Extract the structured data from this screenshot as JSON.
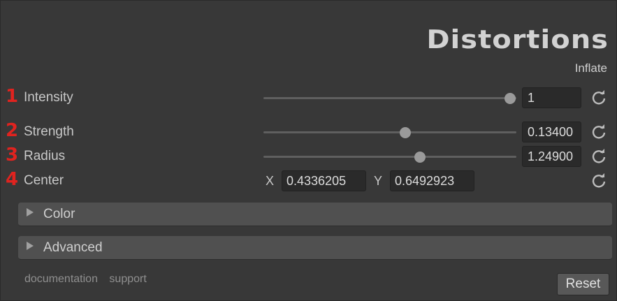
{
  "header": {
    "title": "Distortions",
    "subtitle": "Inflate"
  },
  "properties": [
    {
      "id": "intensity",
      "number": "1",
      "label": "Intensity",
      "value": "1",
      "slider_fraction": 1.0
    },
    {
      "id": "strength",
      "number": "2",
      "label": "Strength",
      "value": "0.13400",
      "slider_fraction": 0.56
    },
    {
      "id": "radius",
      "number": "3",
      "label": "Radius",
      "value": "1.24900",
      "slider_fraction": 0.62
    }
  ],
  "center": {
    "number": "4",
    "label": "Center",
    "x_label": "X",
    "x_value": "0.4336205",
    "y_label": "Y",
    "y_value": "0.6492923"
  },
  "foldouts": {
    "color": "Color",
    "advanced": "Advanced"
  },
  "footer": {
    "documentation": "documentation",
    "support": "support",
    "reset": "Reset"
  },
  "icons": {
    "reset_value": "refresh-icon",
    "foldout": "triangle-right-icon"
  },
  "colors": {
    "number_badge": "#e0231f",
    "background": "#383838"
  }
}
